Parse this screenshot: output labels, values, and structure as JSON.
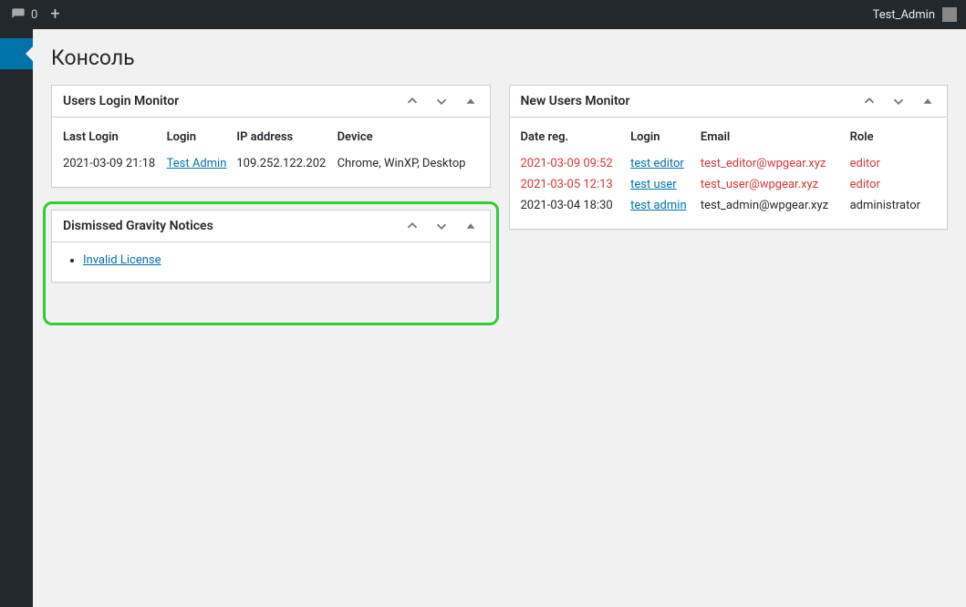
{
  "adminbar": {
    "comment_count": "0",
    "user_label": "Test_Admin"
  },
  "page": {
    "title": "Консоль"
  },
  "widgets": {
    "users_login": {
      "title": "Users Login Monitor",
      "cols": {
        "last_login": "Last Login",
        "login": "Login",
        "ip": "IP address",
        "device": "Device"
      },
      "rows": [
        {
          "last_login": "2021-03-09 21:18",
          "login": "Test Admin",
          "ip": "109.252.122.202",
          "device": "Chrome, WinXP, Desktop"
        }
      ]
    },
    "new_users": {
      "title": "New Users Monitor",
      "cols": {
        "date_reg": "Date reg.",
        "login": "Login",
        "email": "Email",
        "role": "Role"
      },
      "rows": [
        {
          "date_reg": "2021-03-09 09:52",
          "login": "test editor",
          "email": "test_editor@wpgear.xyz",
          "role": "editor",
          "alert": true
        },
        {
          "date_reg": "2021-03-05 12:13",
          "login": "test user",
          "email": "test_user@wpgear.xyz",
          "role": "editor",
          "alert": true
        },
        {
          "date_reg": "2021-03-04 18:30",
          "login": "test admin",
          "email": "test_admin@wpgear.xyz",
          "role": "administrator",
          "alert": false
        }
      ]
    },
    "dismissed_gravity": {
      "title": "Dismissed Gravity Notices",
      "items": [
        "Invalid License"
      ]
    }
  }
}
